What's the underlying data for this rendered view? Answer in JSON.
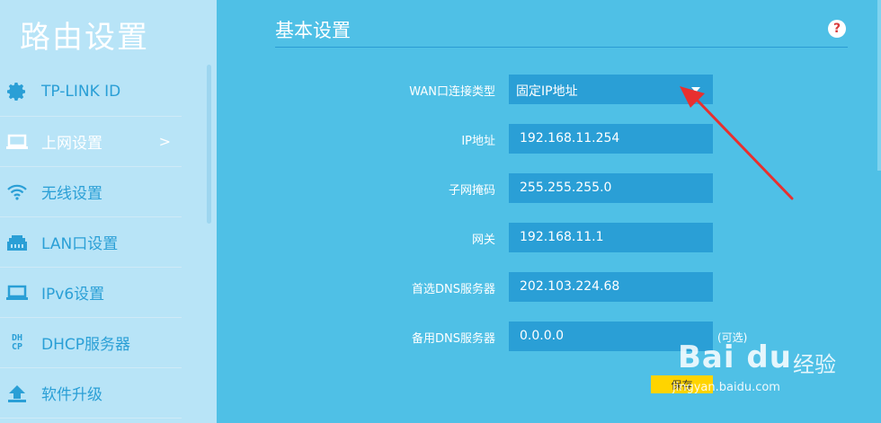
{
  "sidebar": {
    "title": "路由设置",
    "items": [
      {
        "label": "TP-LINK ID",
        "icon": "gear-icon"
      },
      {
        "label": "上网设置",
        "icon": "laptop-icon",
        "arrow": ">"
      },
      {
        "label": "无线设置",
        "icon": "wifi-icon"
      },
      {
        "label": "LAN口设置",
        "icon": "lan-port-icon"
      },
      {
        "label": "IPv6设置",
        "icon": "laptop-icon"
      },
      {
        "label": "DHCP服务器",
        "icon": "dhcp-icon",
        "icon_text_top": "DH",
        "icon_text_bottom": "CP"
      },
      {
        "label": "软件升级",
        "icon": "upload-icon"
      }
    ]
  },
  "main": {
    "section_title": "基本设置",
    "help": "?",
    "form": {
      "wan_type": {
        "label": "WAN口连接类型",
        "value": "固定IP地址"
      },
      "ip": {
        "label": "IP地址",
        "value": "192.168.11.254"
      },
      "mask": {
        "label": "子网掩码",
        "value": "255.255.255.0"
      },
      "gateway": {
        "label": "网关",
        "value": "192.168.11.1"
      },
      "dns1": {
        "label": "首选DNS服务器",
        "value": "202.103.224.68"
      },
      "dns2": {
        "label": "备用DNS服务器",
        "value": "0.0.0.0",
        "note": "(可选)"
      }
    },
    "save_label": "保存"
  },
  "watermark": {
    "logo": "Bai du",
    "text": "经验",
    "url": "jingyan.baidu.com"
  },
  "colors": {
    "background": "#4fc0e6",
    "sidebar": "#b8e4f7",
    "field": "#2a9fd6",
    "accent": "#ffd400",
    "arrow": "#e8302f"
  }
}
